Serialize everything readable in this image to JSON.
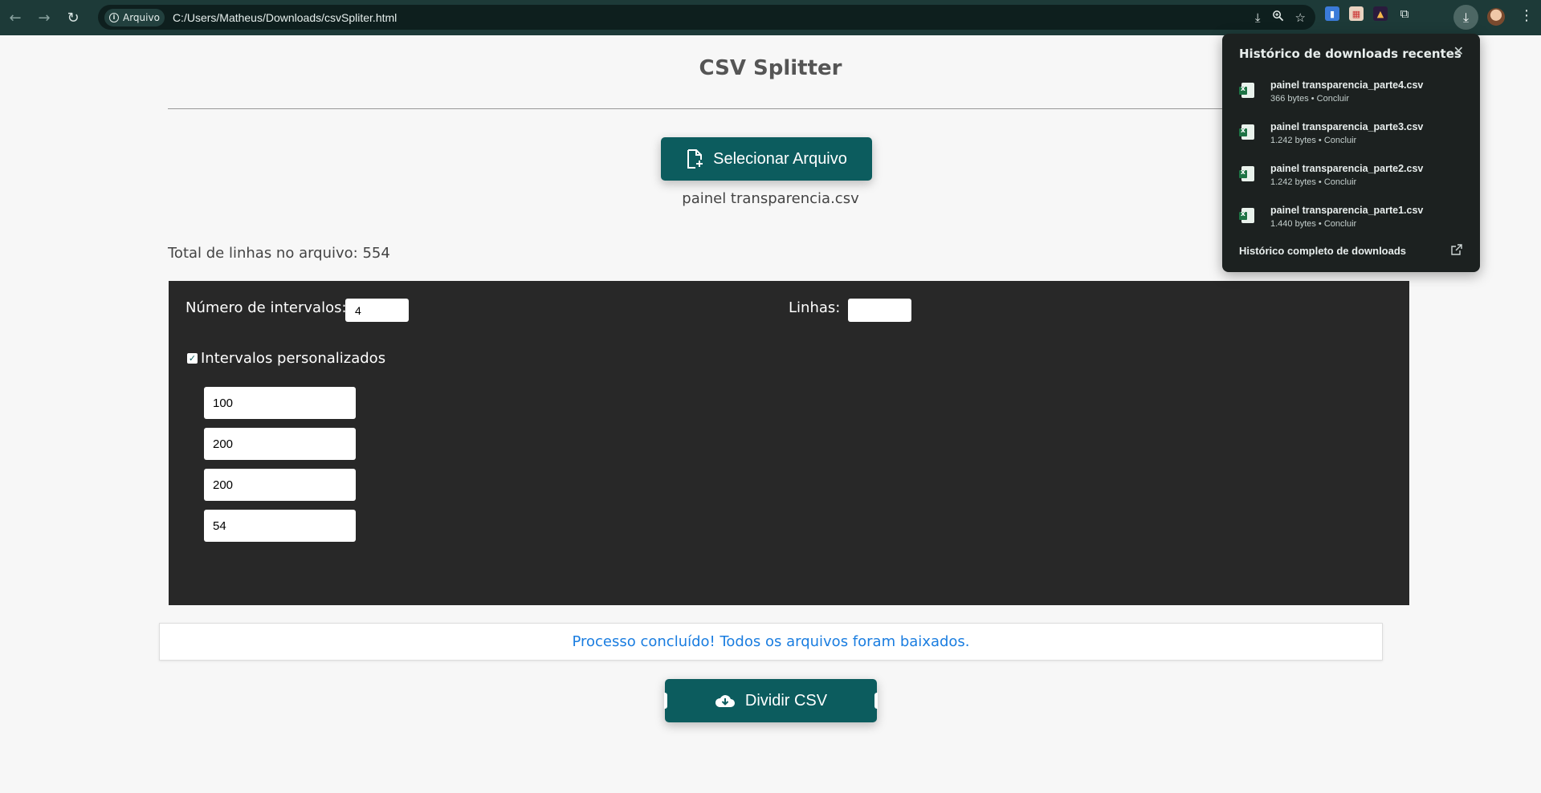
{
  "browser": {
    "site_label": "Arquivo",
    "url": "C:/Users/Matheus/Downloads/csvSpliter.html",
    "colors": {
      "toolbar": "#1d3a38",
      "omnibox": "#0e1f1e"
    }
  },
  "page": {
    "title": "CSV Splitter",
    "select_button_label": "Selecionar Arquivo",
    "selected_file": "painel transparencia.csv",
    "total_lines_text": "Total de linhas no arquivo: 554",
    "accent_color": "#0c5c5e"
  },
  "panel": {
    "intervals_label": "Número de intervalos:",
    "intervals_value": "4",
    "lines_label": "Linhas:",
    "lines_value": "",
    "custom_intervals_label": "Intervalos personalizados",
    "custom_intervals_checked": true,
    "interval_values": [
      "100",
      "200",
      "200",
      "54"
    ]
  },
  "status": {
    "message": "Processo concluído! Todos os arquivos foram baixados.",
    "color": "#1a7de0"
  },
  "split_button_label": "Dividir CSV",
  "downloads": {
    "title": "Histórico de downloads recentes",
    "items": [
      {
        "name": "painel transparencia_parte4.csv",
        "meta": "366 bytes • Concluir"
      },
      {
        "name": "painel transparencia_parte3.csv",
        "meta": "1.242 bytes • Concluir"
      },
      {
        "name": "painel transparencia_parte2.csv",
        "meta": "1.242 bytes • Concluir"
      },
      {
        "name": "painel transparencia_parte1.csv",
        "meta": "1.440 bytes • Concluir"
      }
    ],
    "full_history_label": "Histórico completo de downloads"
  }
}
